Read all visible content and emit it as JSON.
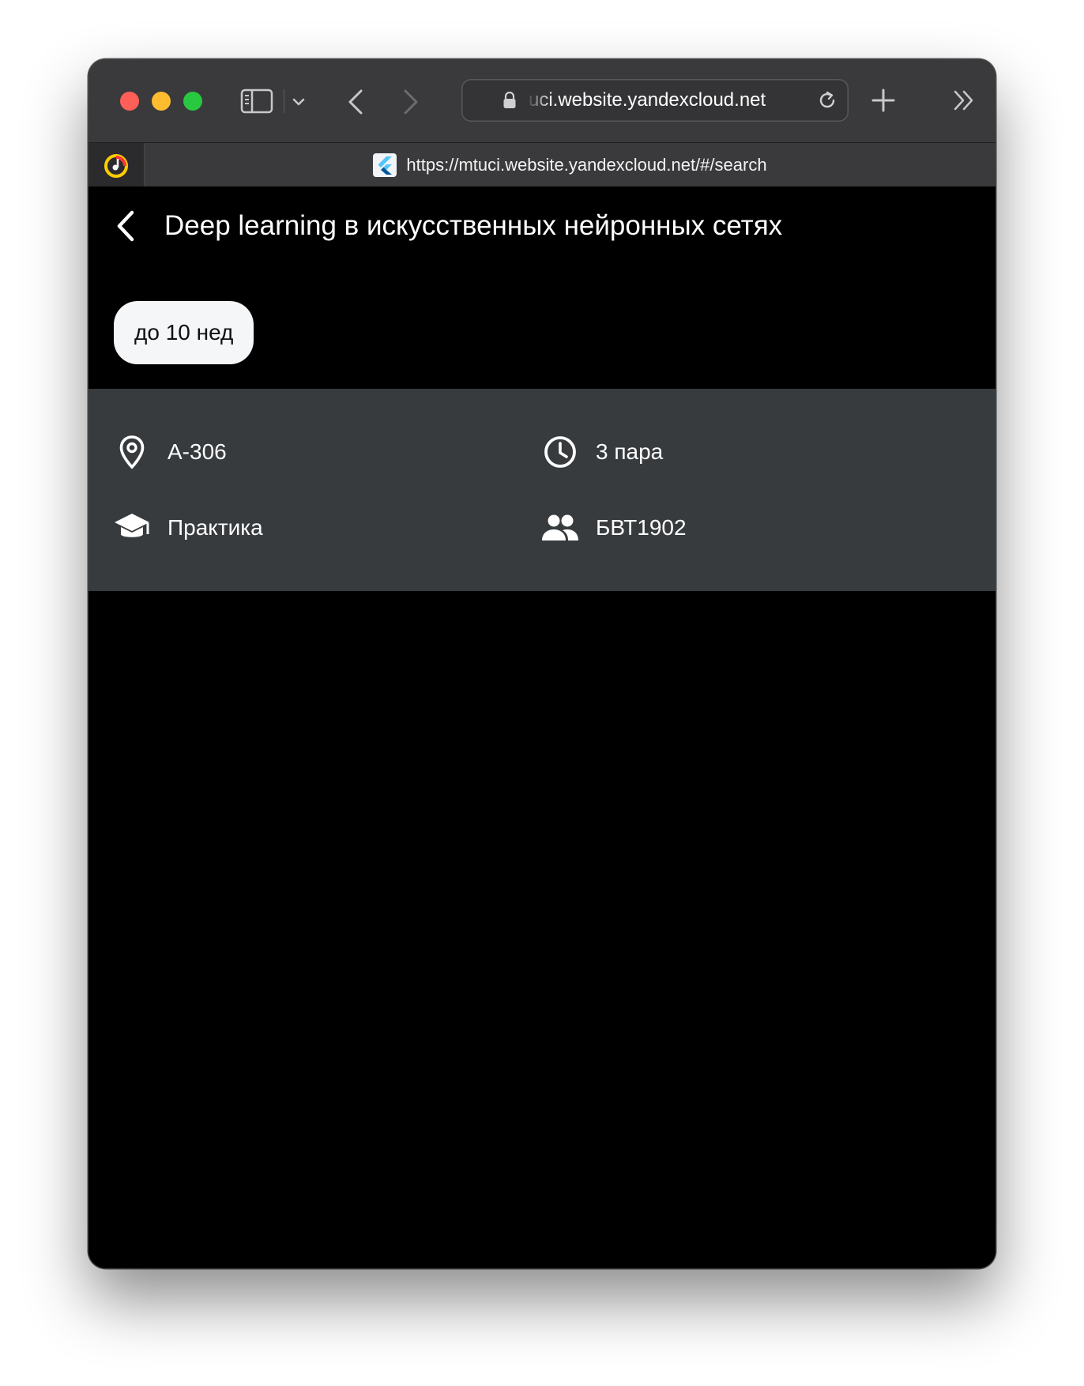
{
  "browser": {
    "address_text": "uci.website.yandexcloud.net",
    "tab": {
      "title": "https://mtuci.website.yandexcloud.net/#/search"
    }
  },
  "lesson": {
    "title": "Deep learning в искусственных нейронных сетях",
    "weeks_chip": "до 10 нед",
    "room": "А-306",
    "time": "3 пара",
    "type": "Практика",
    "group": "БВТ1902"
  },
  "icons": {
    "room": "location-pin-icon",
    "time": "clock-icon",
    "type": "graduation-cap-icon",
    "group": "people-icon"
  },
  "colors": {
    "page_background": "#000000",
    "info_panel": "#373b3e",
    "chip_background": "#f5f6f8",
    "titlebar": "#3a3a3c"
  }
}
